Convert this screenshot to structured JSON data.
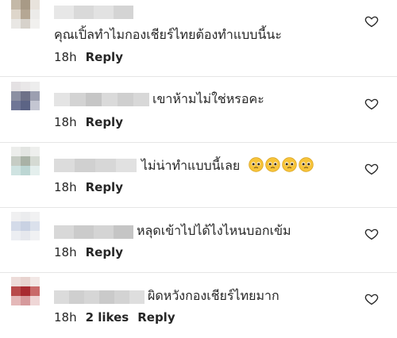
{
  "comments": [
    {
      "text": "คุณเปิ้ลทำไมกองเชียร์ไทยต้องทำแบบนี้นะ",
      "time": "18h",
      "likes": "",
      "reply": "Reply",
      "emoji_count": 0
    },
    {
      "text": "เขาห้ามไม่ใช่หรอคะ",
      "time": "18h",
      "likes": "",
      "reply": "Reply",
      "emoji_count": 0
    },
    {
      "text": "ไม่น่าทำแบบนี้เลย",
      "time": "18h",
      "likes": "",
      "reply": "Reply",
      "emoji_count": 4
    },
    {
      "text": "หลุดเข้าไปได้ไงไหนบอกเข้ม",
      "time": "18h",
      "likes": "",
      "reply": "Reply",
      "emoji_count": 0
    },
    {
      "text": "ผิดหวังกองเชียร์ไทยมาก",
      "time": "18h",
      "likes": "2 likes",
      "reply": "Reply",
      "emoji_count": 0
    }
  ],
  "icons": {
    "like": "heart-outline-icon",
    "emoji": "pleading-face-emoji"
  },
  "colors": {
    "text": "#262626",
    "divider": "#e6e6e6",
    "heart_stroke": "#262626",
    "emoji_face": "#f7c43a"
  }
}
